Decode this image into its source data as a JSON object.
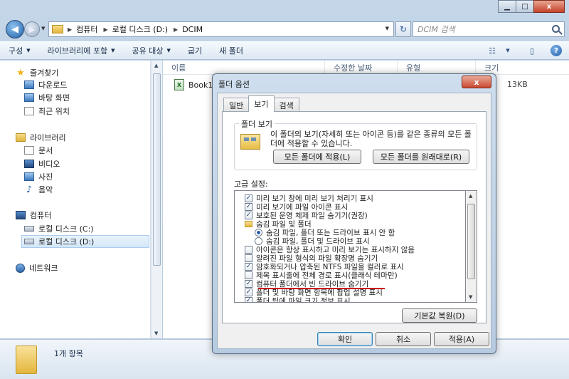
{
  "window": {
    "caption": {
      "minimize": "▁",
      "maximize": "□",
      "close": "x"
    }
  },
  "address": {
    "segments": [
      "컴퓨터",
      "로컬 디스크 (D:)",
      "DCIM"
    ],
    "search_placeholder": "DCIM 검색"
  },
  "toolbar": {
    "organize": "구성",
    "include_library": "라이브러리에 포함",
    "share": "공유 대상",
    "burn": "굽기",
    "new_folder": "새 폴더",
    "help": "?"
  },
  "sidebar": {
    "favorites": "즐겨찾기",
    "downloads": "다운로드",
    "desktop": "바탕 화면",
    "recent": "최근 위치",
    "libraries": "라이브러리",
    "documents": "문서",
    "videos": "비디오",
    "pictures": "사진",
    "music": "음악",
    "computer": "컴퓨터",
    "drive_c": "로컬 디스크 (C:)",
    "drive_d": "로컬 디스크 (D:)",
    "network": "네트워크"
  },
  "filelist": {
    "columns": [
      "이름",
      "수정한 날짜",
      "유형",
      "크기"
    ],
    "rows": [
      {
        "name": "Book1",
        "size": "13KB"
      }
    ]
  },
  "status": {
    "count": "1개 항목"
  },
  "dialog": {
    "title": "폴더 옵션",
    "close": "x",
    "tabs": [
      "일반",
      "보기",
      "검색"
    ],
    "active_tab": "보기",
    "folder_view": {
      "group_title": "폴더 보기",
      "description": "이 폴더의 보기(자세히 또는 아이콘 등)를 같은 종류의 모든 폴더에 적용할 수 있습니다.",
      "apply_button": "모든 폴더에 적용(L)",
      "reset_button": "모든 폴더를 원래대로(R)"
    },
    "advanced_label": "고급 설정:",
    "advanced_items": [
      {
        "type": "checkbox",
        "checked": true,
        "label": "미리 보기 창에 미리 보기 처리기 표시",
        "indent": 1
      },
      {
        "type": "checkbox",
        "checked": true,
        "label": "미리 보기에 파일 아이콘 표시",
        "indent": 1
      },
      {
        "type": "checkbox",
        "checked": true,
        "label": "보호된 운영 체제 파일 숨기기(권장)",
        "indent": 1
      },
      {
        "type": "folder",
        "label": "숨김 파일 및 폴더",
        "indent": 1
      },
      {
        "type": "radio",
        "checked": true,
        "label": "숨김 파일, 폴더 또는 드라이브 표시 안 함",
        "indent": 2
      },
      {
        "type": "radio",
        "checked": false,
        "label": "숨김 파일, 폴더 및 드라이브 표시",
        "indent": 2
      },
      {
        "type": "checkbox",
        "checked": false,
        "label": "아이콘은 항상 표시하고 미리 보기는 표시하지 않음",
        "indent": 1
      },
      {
        "type": "checkbox",
        "checked": false,
        "label": "알려진 파일 형식의 파일 확장명 숨기기",
        "indent": 1
      },
      {
        "type": "checkbox",
        "checked": true,
        "label": "암호화되거나 압축된 NTFS 파일을 컬러로 표시",
        "indent": 1
      },
      {
        "type": "checkbox",
        "checked": false,
        "label": "제목 표시줄에 전체 경로 표시(클래식 테마만)",
        "indent": 1
      },
      {
        "type": "checkbox",
        "checked": true,
        "label": "컴퓨터 폴더에서 빈 드라이브 숨기기",
        "indent": 1
      },
      {
        "type": "checkbox",
        "checked": true,
        "label": "폴더 및 바탕 화면 항목에 팝업 설명 표시",
        "indent": 1
      },
      {
        "type": "checkbox",
        "checked": true,
        "label": "폴더 팁에 파일 크기 정보 표시",
        "indent": 1
      }
    ],
    "restore_defaults": "기본값 복원(D)",
    "ok": "확인",
    "cancel": "취소",
    "apply": "적용(A)"
  },
  "colors": {
    "highlight_underline": "#d0141b",
    "accent": "#1d5fa8"
  }
}
